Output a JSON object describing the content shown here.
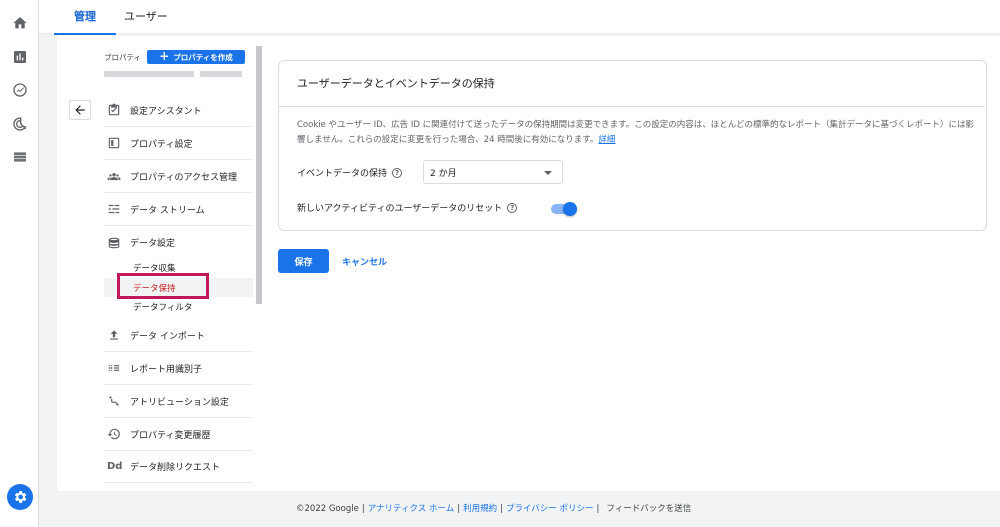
{
  "tabs": [
    {
      "label": "管理",
      "active": true
    },
    {
      "label": "ユーザー",
      "active": false
    }
  ],
  "rail_icons": [
    "home-icon",
    "reports-icon",
    "explore-icon",
    "advertising-icon",
    "configure-icon",
    "settings-icon"
  ],
  "sidebar": {
    "property_label": "プロパティ",
    "create_property_label": "プロパティを作成",
    "items": [
      {
        "label": "設定アシスタント",
        "icon": "checklist-icon"
      },
      {
        "label": "プロパティ設定",
        "icon": "property-settings-icon"
      },
      {
        "label": "プロパティのアクセス管理",
        "icon": "people-icon"
      },
      {
        "label": "データ ストリーム",
        "icon": "data-stream-icon"
      },
      {
        "label": "データ設定",
        "icon": "database-icon"
      },
      {
        "label": "データ インポート",
        "icon": "upload-icon"
      },
      {
        "label": "レポート用識別子",
        "icon": "identity-icon"
      },
      {
        "label": "アトリビューション設定",
        "icon": "attribution-icon"
      },
      {
        "label": "プロパティ変更履歴",
        "icon": "history-icon"
      },
      {
        "label": "データ削除リクエスト",
        "icon": "dd-icon"
      }
    ],
    "data_settings_sub": [
      {
        "label": "データ収集",
        "active": false
      },
      {
        "label": "データ保持",
        "active": true
      },
      {
        "label": "データフィルタ",
        "active": false
      }
    ]
  },
  "card": {
    "title": "ユーザーデータとイベントデータの保持",
    "description": "Cookie やユーザー ID、広告 ID に関連付けて送ったデータの保持期間は変更できます。この設定の内容は、ほとんどの標準的なレポート（集計データに基づくレポート）には影響しません。これらの設定に変更を行った場合、24 時間後に有効になります。",
    "description_link": "詳細",
    "event_retention_label": "イベントデータの保持",
    "event_retention_value": "2 か月",
    "reset_label": "新しいアクティビティのユーザーデータのリセット",
    "reset_enabled": true
  },
  "actions": {
    "save_label": "保存",
    "cancel_label": "キャンセル"
  },
  "footer": {
    "copyright": "©2022 Google",
    "links": [
      "アナリティクス ホーム",
      "利用規約",
      "プライバシー ポリシー"
    ],
    "feedback": "フィードバックを送信"
  },
  "colors": {
    "accent": "#1a73e8",
    "highlight_border": "#c2185b",
    "active_sub_text": "#c5221f"
  }
}
